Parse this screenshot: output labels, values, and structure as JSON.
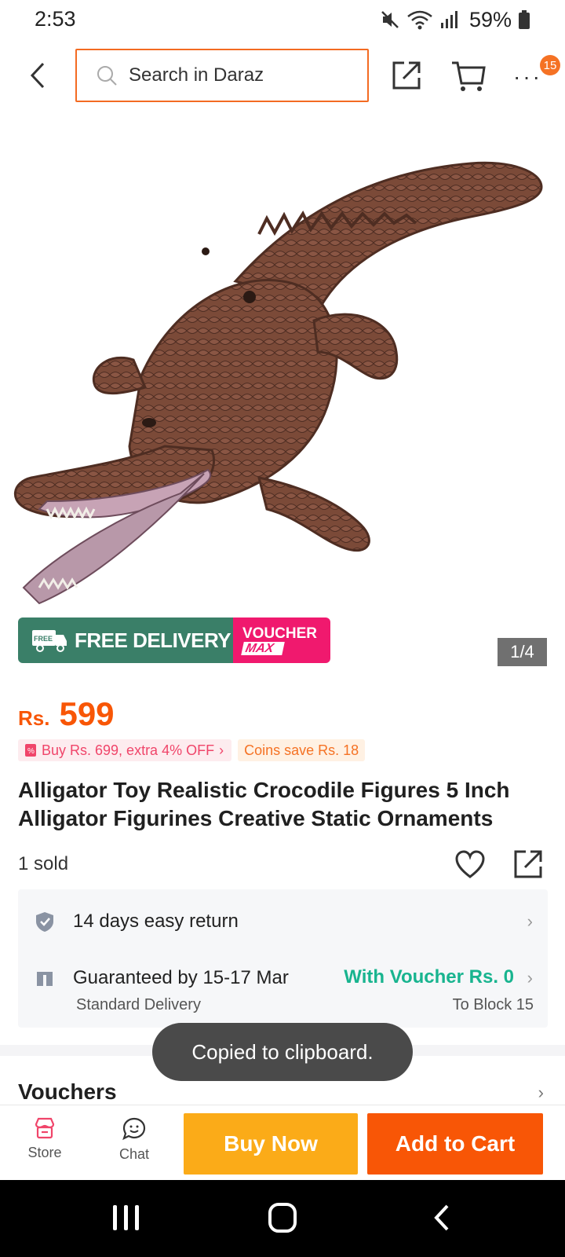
{
  "status_bar": {
    "time": "2:53",
    "battery": "59%",
    "icons": [
      "mute-icon",
      "wifi-icon",
      "signal-icon",
      "battery-icon"
    ]
  },
  "header": {
    "search_placeholder": "Search in Daraz",
    "notification_count": "15",
    "icons": [
      "back-icon",
      "search-icon",
      "share-icon",
      "cart-icon",
      "more-icon"
    ]
  },
  "product": {
    "image_counter": "1/4",
    "badges": {
      "free_delivery": "FREE DELIVERY",
      "free_tag": "FREE",
      "voucher_line1": "VOUCHER",
      "voucher_line2": "MAX"
    },
    "price_currency": "Rs.",
    "price": "599",
    "promo": "Buy Rs. 699, extra 4% OFF",
    "coins": "Coins save Rs. 18",
    "title": "Alligator Toy Realistic Crocodile Figures 5 Inch Alligator Figurines Creative Static Ornaments",
    "sold": "1 sold"
  },
  "services": {
    "return_policy": "14 days easy return",
    "delivery_guarantee": "Guaranteed by 15-17 Mar",
    "voucher_price": "With Voucher Rs. 0",
    "delivery_type": "Standard Delivery",
    "delivery_location": "To Block 15"
  },
  "vouchers": {
    "title": "Vouchers"
  },
  "toast": {
    "message": "Copied to clipboard."
  },
  "action_bar": {
    "store_label": "Store",
    "chat_label": "Chat",
    "buy_now": "Buy Now",
    "add_to_cart": "Add to Cart"
  },
  "colors": {
    "accent_orange": "#f85606",
    "buy_now_yellow": "#fbab18",
    "voucher_green": "#18b48f",
    "free_delivery_green": "#3a7f68",
    "voucher_pink": "#f0196e"
  }
}
